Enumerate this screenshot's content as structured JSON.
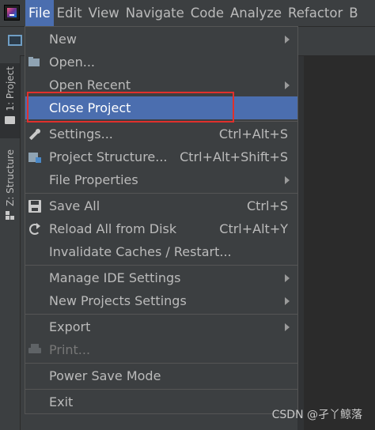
{
  "menubar": {
    "items": [
      {
        "label": "File",
        "active": true
      },
      {
        "label": "Edit"
      },
      {
        "label": "View"
      },
      {
        "label": "Navigate"
      },
      {
        "label": "Code"
      },
      {
        "label": "Analyze"
      },
      {
        "label": "Refactor"
      },
      {
        "label": "B"
      }
    ]
  },
  "toolstrip": {
    "project_tab": "1: Project",
    "structure_tab": "Z: Structure"
  },
  "file_menu": {
    "new": "New",
    "open": "Open...",
    "open_recent": "Open Recent",
    "close_project": "Close Project",
    "settings": "Settings...",
    "settings_shortcut": "Ctrl+Alt+S",
    "project_structure": "Project Structure...",
    "project_structure_shortcut": "Ctrl+Alt+Shift+S",
    "file_properties": "File Properties",
    "save_all": "Save All",
    "save_all_shortcut": "Ctrl+S",
    "reload_all": "Reload All from Disk",
    "reload_all_shortcut": "Ctrl+Alt+Y",
    "invalidate_caches": "Invalidate Caches / Restart...",
    "manage_ide_settings": "Manage IDE Settings",
    "new_projects_settings": "New Projects Settings",
    "export": "Export",
    "print": "Print...",
    "power_save_mode": "Power Save Mode",
    "exit": "Exit"
  },
  "icons": {
    "open": "folder-open-icon",
    "settings": "wrench-icon",
    "project_structure": "project-structure-icon",
    "save_all": "save-icon",
    "reload_all": "reload-icon",
    "print": "printer-icon"
  },
  "colors": {
    "selection": "#4b6eaf",
    "annotation_box": "#e0302c"
  },
  "watermark": "CSDN @孑丫鲸落"
}
